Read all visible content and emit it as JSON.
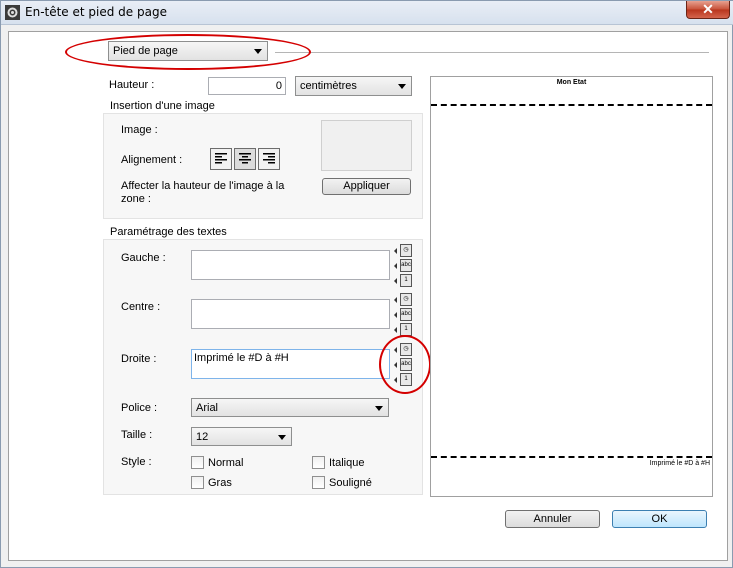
{
  "window": {
    "title": "En-tête et pied de page",
    "close_glyph": "✕"
  },
  "section_select": {
    "value": "Pied de page"
  },
  "height": {
    "label": "Hauteur :",
    "value": "0",
    "unit": "centimètres"
  },
  "image_group": {
    "title": "Insertion d'une image",
    "image_label": "Image :",
    "alignment_label": "Alignement :",
    "affect_label_line1": "Affecter la hauteur de l'image à la",
    "affect_label_line2": "zone :",
    "apply_button": "Appliquer"
  },
  "text_group": {
    "title": "Paramétrage des textes",
    "left_label": "Gauche :",
    "left_value": "",
    "center_label": "Centre :",
    "center_value": "",
    "right_label": "Droite :",
    "right_value": "Imprimé le #D à #H",
    "font_label": "Police :",
    "font_value": "Arial",
    "size_label": "Taille :",
    "size_value": "12",
    "style_label": "Style :",
    "styles": {
      "normal": "Normal",
      "italic": "Italique",
      "bold": "Gras",
      "underline": "Souligné"
    }
  },
  "preview": {
    "header_text": "Mon Etat",
    "footer_text": "Imprimé le #D à #H"
  },
  "buttons": {
    "cancel": "Annuler",
    "ok": "OK"
  },
  "icons": {
    "app": "gear-icon",
    "clock": "clock-icon",
    "abc": "abc-page-icon",
    "page_number": "page-number-icon",
    "align_left": "align-left-icon",
    "align_center": "align-center-icon",
    "align_right": "align-right-icon"
  },
  "colors": {
    "annotation": "#d40000",
    "ok_border": "#3c7fb1"
  }
}
